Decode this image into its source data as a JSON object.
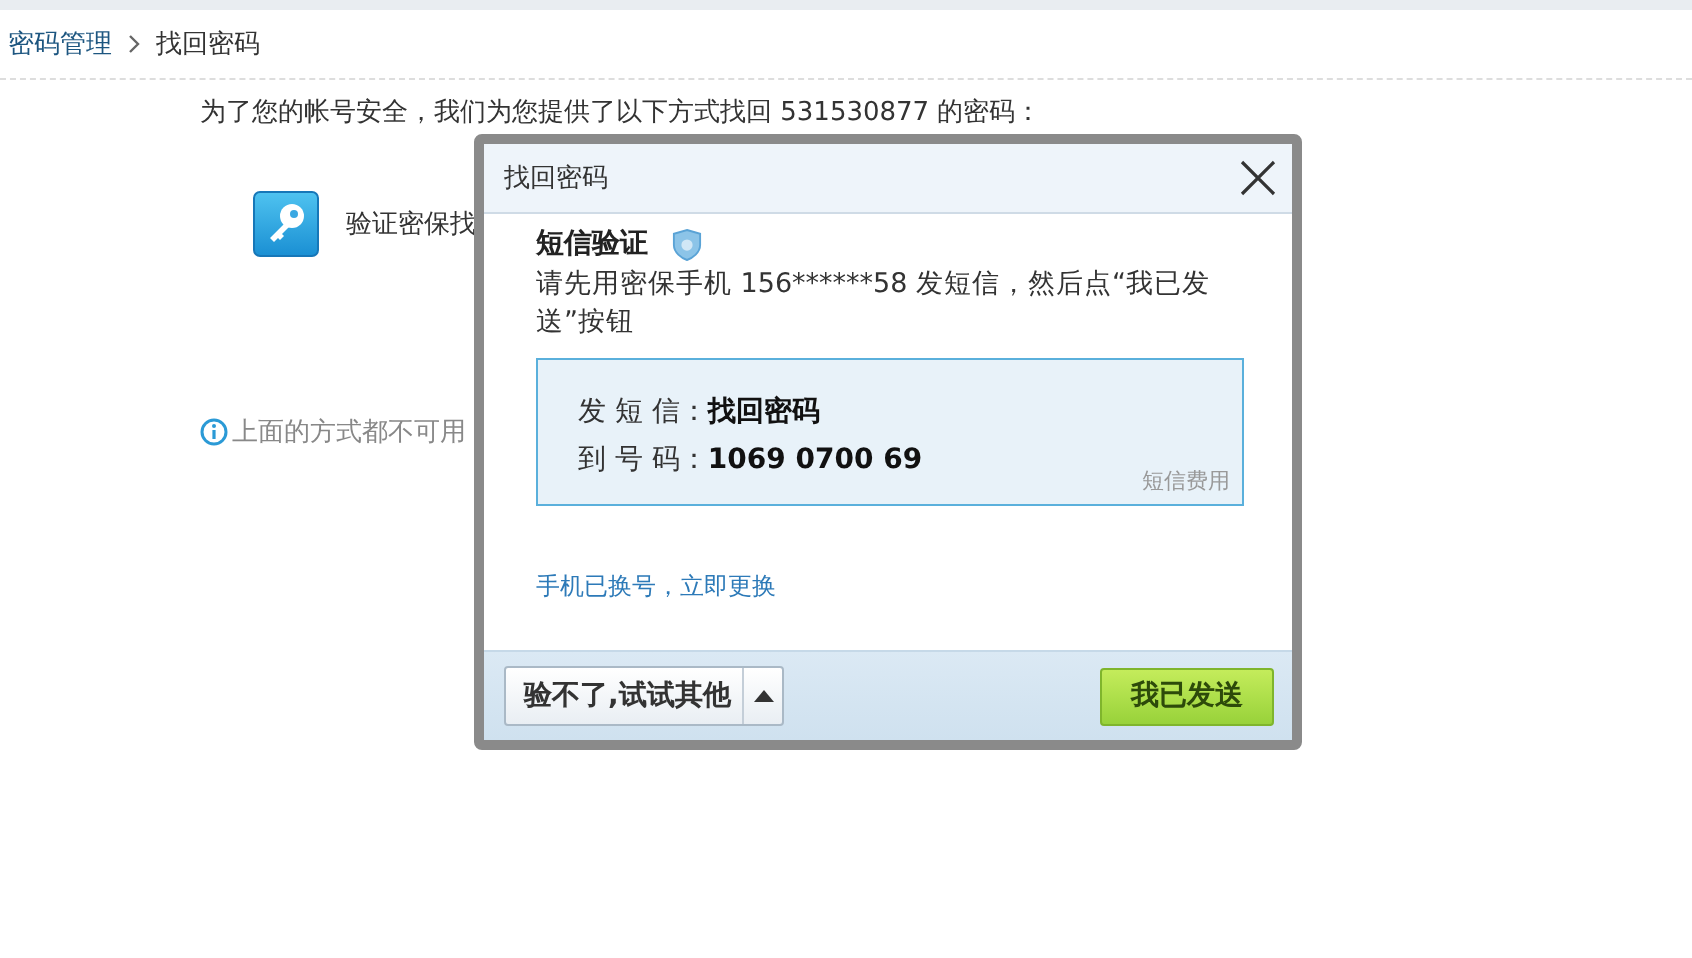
{
  "breadcrumb": [
    {
      "label": "密码管理",
      "link": true
    },
    {
      "label": "找回密码",
      "link": false
    }
  ],
  "intro": "为了您的帐号安全，我们为您提供了以下方式找回 531530877 的密码：",
  "method": {
    "label": "验证密保找"
  },
  "fallback": {
    "label": "上面的方式都不可用"
  },
  "dialog": {
    "title": "找回密码",
    "heading": "短信验证",
    "instruction": "请先用密保手机 156******58 发短信，然后点“我已发送”按钮",
    "sms": [
      {
        "label": "发 短 信：",
        "value": "找回密码"
      },
      {
        "label": "到 号 码：",
        "value": "1069 0700 69"
      }
    ],
    "fee_note": "短信费用",
    "change_link": "手机已换号，立即更换",
    "other_button": "验不了,试试其他",
    "confirm_button": "我已发送"
  }
}
